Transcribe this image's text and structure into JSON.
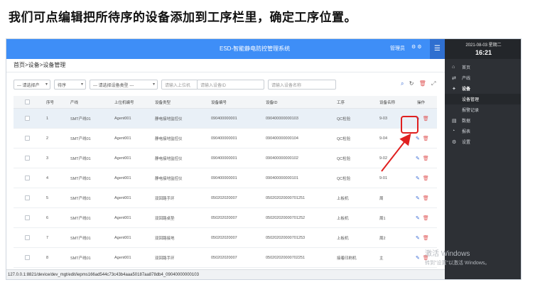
{
  "caption": "我们可点编辑把所待序的设备添加到工序栏里，确定工序位置。",
  "header": {
    "title": "ESD-智能静电防控管理系统",
    "user_label": "管理员",
    "user_icons": "⚙ ⚙",
    "menu_icon": "hamburger-icon"
  },
  "clock": {
    "date": "2021-08-03 星期二",
    "time": "16:21"
  },
  "sidebar": {
    "items": [
      {
        "label": "首页",
        "icon": "home-icon",
        "glyph": "⌂"
      },
      {
        "label": "产线",
        "icon": "swap-icon",
        "glyph": "⇄"
      },
      {
        "label": "设备",
        "icon": "devices-icon",
        "glyph": "✦"
      },
      {
        "label": "设备管理",
        "sub": true,
        "active": true
      },
      {
        "label": "报警记录",
        "sub": true
      },
      {
        "label": "数据",
        "icon": "database-icon",
        "glyph": "▤"
      },
      {
        "label": "报表",
        "icon": "chart-icon",
        "glyph": "◔"
      },
      {
        "label": "设置",
        "icon": "settings-icon",
        "glyph": "⚙"
      }
    ]
  },
  "breadcrumb": "首页>设备>设备管理",
  "filters": {
    "line_select": "--- 请选择产",
    "process_select": "待序",
    "type_select": "--- 请选择设备类型 ---",
    "host_placeholder": "请输入上位机",
    "id_placeholder": "请输入设备ID",
    "name_placeholder": "请输入设备名称"
  },
  "columns": [
    "序号",
    "产线",
    "上位机编号",
    "设备类型",
    "设备编号",
    "设备ID",
    "工序",
    "设备名称",
    "操作"
  ],
  "rows": [
    [
      "1",
      "SMT产线01",
      "Agent001",
      "静电接地监控仪",
      "090400000001",
      "090400000000103",
      "QC检验",
      "9-03"
    ],
    [
      "2",
      "SMT产线01",
      "Agent001",
      "静电接地监控仪",
      "090400000001",
      "090400000000104",
      "QC检验",
      "9-04"
    ],
    [
      "3",
      "SMT产线01",
      "Agent001",
      "静电接地监控仪",
      "090400000001",
      "090400000000102",
      "QC检验",
      "9-02"
    ],
    [
      "4",
      "SMT产线01",
      "Agent001",
      "静电接地监控仪",
      "090400000001",
      "090400000000101",
      "QC检验",
      "9-01"
    ],
    [
      "5",
      "SMT产线01",
      "Agent001",
      "双回路手环",
      "050202020007",
      "050202020000701251",
      "上板机",
      "周"
    ],
    [
      "6",
      "SMT产线01",
      "Agent001",
      "双回路桌垫",
      "050202020007",
      "050202020000701252",
      "上板机",
      "周1"
    ],
    [
      "7",
      "SMT产线01",
      "Agent001",
      "双回路接地",
      "050202020007",
      "050202020000701253",
      "上板机",
      "周2"
    ],
    [
      "8",
      "SMT产线01",
      "Agent001",
      "双回路手环",
      "050202020007",
      "050202020000702251",
      "接着印刷机",
      "主"
    ]
  ],
  "status_url": "127.0.0.1:8821/device/dev_mgt/edit/iepms166ad544c73c43b4aaa50187aa878db4_09040000000103",
  "watermark": {
    "line1": "激活 Windows",
    "line2": "转到\"设置\"以激活 Windows。"
  },
  "colors": {
    "topbar": "#3e8ef7",
    "sidebar": "#2d3035",
    "highlight": "#e02020"
  }
}
